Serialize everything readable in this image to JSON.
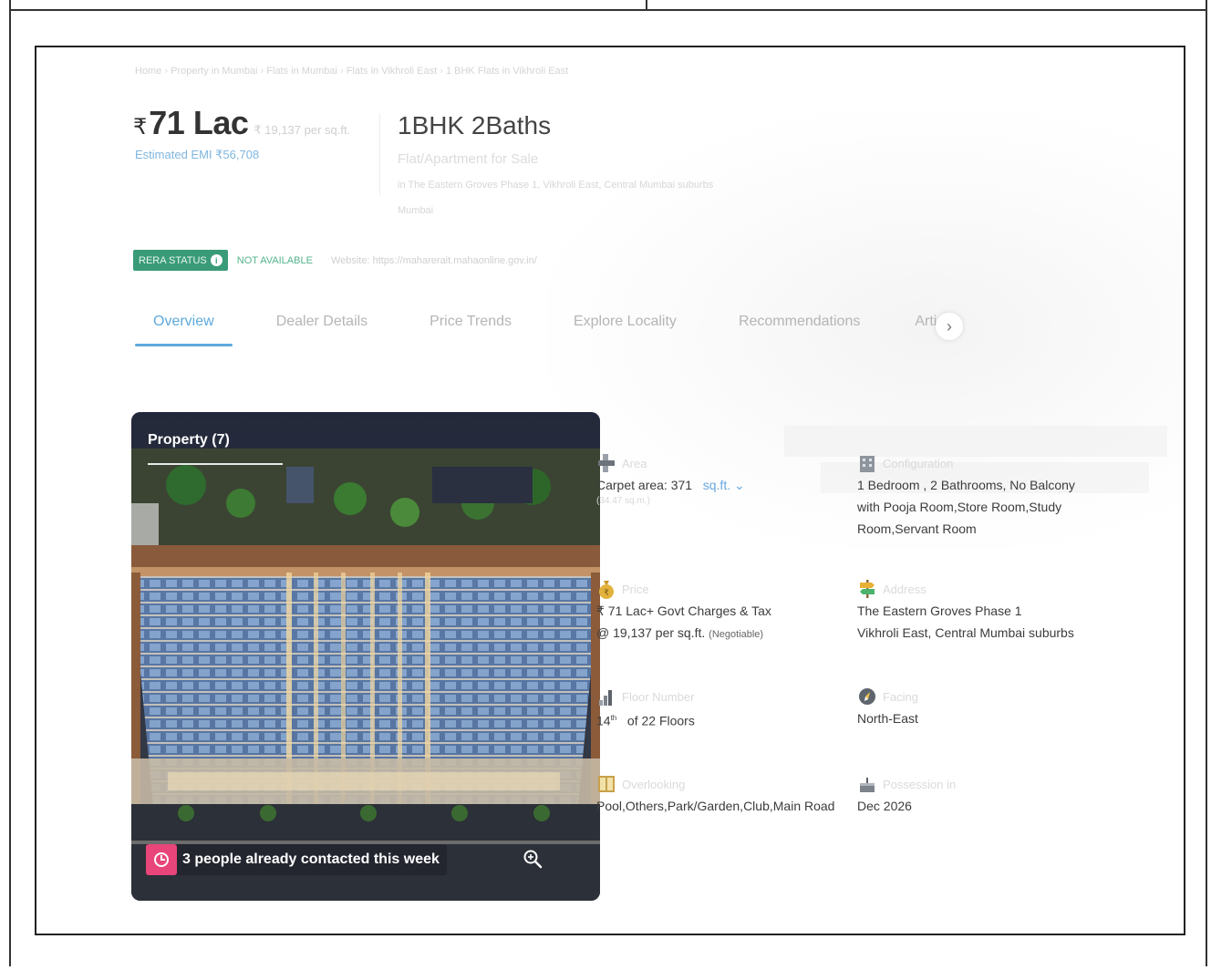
{
  "breadcrumb": [
    "Home",
    "Property in Mumbai",
    "Flats in Mumbai",
    "Flats in Vikhroli East",
    "1 BHK Flats in Vikhroli East"
  ],
  "price": {
    "currency": "₹",
    "value": "71 Lac",
    "per_sqft": "₹ 19,137 per sq.ft.",
    "emi": "Estimated EMI ₹56,708"
  },
  "title": "1BHK 2Baths",
  "subtype": "Flat/Apartment for Sale",
  "project_line": "in The Eastern Groves Phase 1, Vikhroli East, Central Mumbai suburbs",
  "city": "Mumbai",
  "rera": {
    "badge": "RERA STATUS",
    "status": "NOT AVAILABLE",
    "website": "Website: https://maharerait.mahaonline.gov.in/"
  },
  "tabs": [
    "Overview",
    "Dealer Details",
    "Price Trends",
    "Explore Locality",
    "Recommendations",
    "Articl"
  ],
  "card": {
    "title": "Property (7)",
    "contact": "3 people already contacted this week"
  },
  "details": {
    "area": {
      "label": "Area",
      "value": "Carpet area: 371",
      "unit": "sq.ft.",
      "sub": "(34.47 sq.m.)"
    },
    "configuration": {
      "label": "Configuration",
      "lines": [
        "1 Bedroom , 2 Bathrooms, No Balcony",
        "with Pooja Room,Store Room,Study",
        "Room,Servant Room"
      ]
    },
    "price": {
      "label": "Price",
      "line1": "₹ 71 Lac+ Govt Charges & Tax",
      "line2": "@ 19,137 per sq.ft.",
      "negotiable": "(Negotiable)"
    },
    "address": {
      "label": "Address",
      "line1": "The Eastern Groves Phase 1",
      "line2": "Vikhroli East, Central Mumbai suburbs"
    },
    "floor": {
      "label": "Floor Number",
      "number": "14",
      "suffix": "th",
      "rest": "of 22 Floors"
    },
    "facing": {
      "label": "Facing",
      "value": "North-East"
    },
    "overlooking": {
      "label": "Overlooking",
      "value": "Pool,Others,Park/Garden,Club,Main Road"
    },
    "possession": {
      "label": "Possession in",
      "value": "Dec 2026"
    }
  },
  "colors": {
    "accent": "#5fa9dc",
    "rera_green": "#3a9b79",
    "contact_pink": "#e8457a"
  }
}
